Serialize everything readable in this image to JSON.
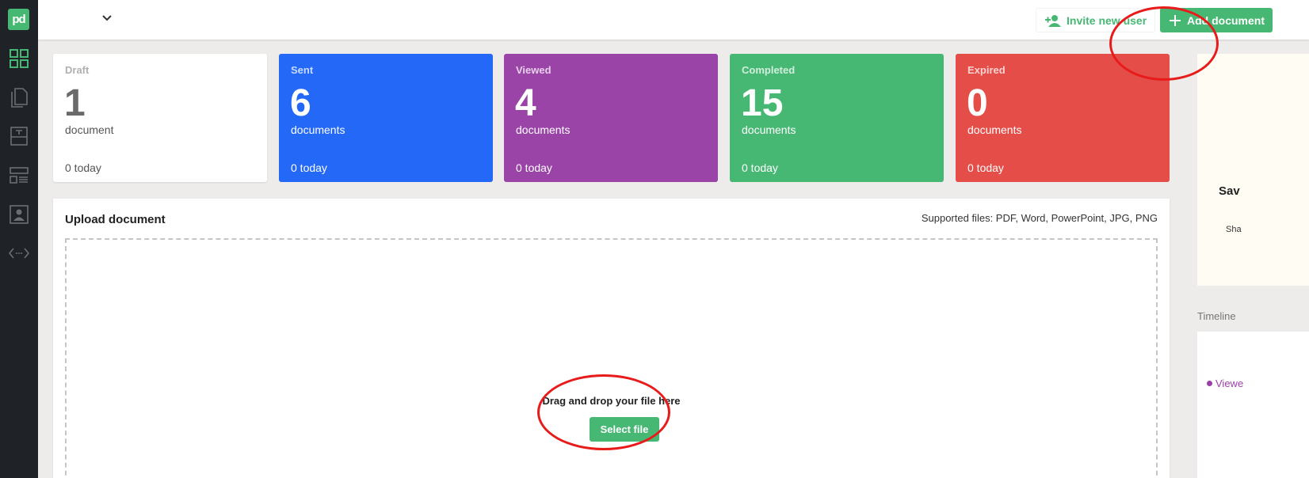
{
  "app": {
    "logo_text": "pd",
    "brand_color": "#47b873"
  },
  "sidebar": {
    "items": [
      {
        "icon": "dashboard-grid-icon",
        "active": true
      },
      {
        "icon": "documents-icon",
        "active": false
      },
      {
        "icon": "templates-icon",
        "active": false
      },
      {
        "icon": "catalog-icon",
        "active": false
      },
      {
        "icon": "contacts-icon",
        "active": false
      },
      {
        "icon": "integrations-code-icon",
        "active": false
      }
    ]
  },
  "header": {
    "invite_label": "Invite new user",
    "add_document_label": "Add document"
  },
  "stats": [
    {
      "label": "Draft",
      "count": "1",
      "unit": "document",
      "today": "0 today",
      "color": "#ffffff"
    },
    {
      "label": "Sent",
      "count": "6",
      "unit": "documents",
      "today": "0 today",
      "color": "#2468f8"
    },
    {
      "label": "Viewed",
      "count": "4",
      "unit": "documents",
      "today": "0 today",
      "color": "#9a44a8"
    },
    {
      "label": "Completed",
      "count": "15",
      "unit": "documents",
      "today": "0 today",
      "color": "#47b873"
    },
    {
      "label": "Expired",
      "count": "0",
      "unit": "documents",
      "today": "0 today",
      "color": "#e44d48"
    }
  ],
  "upload": {
    "title": "Upload document",
    "supported": "Supported files: PDF, Word, PowerPoint, JPG, PNG",
    "drop_text": "Drag and drop your file here",
    "select_label": "Select file"
  },
  "right_panel": {
    "promo_title": "Sav",
    "promo_subtitle": "Sha",
    "timeline_label": "Timeline",
    "timeline_status": "Viewe"
  }
}
